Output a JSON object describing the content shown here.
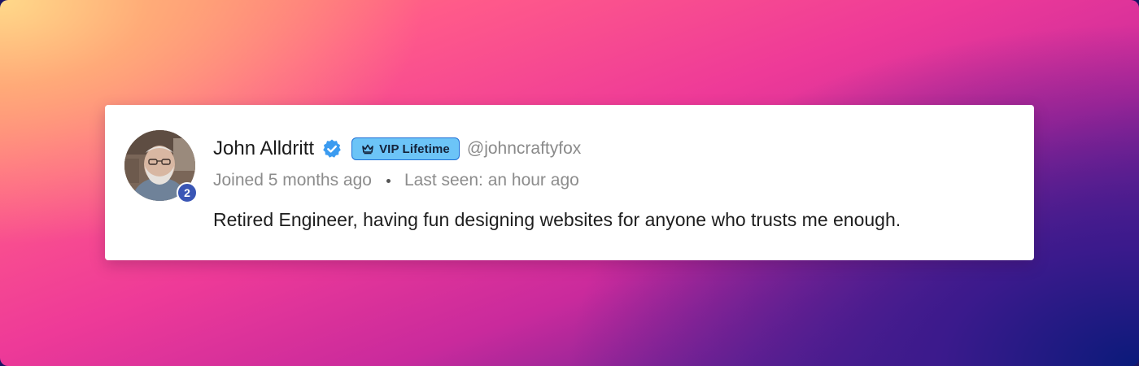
{
  "profile": {
    "name": "John Alldritt",
    "verified_icon": "verified-check-icon",
    "vip_badge": {
      "icon": "crown-icon",
      "label": "VIP Lifetime"
    },
    "handle": "@johncraftyfox",
    "avatar_level": "2",
    "joined": "Joined 5 months ago",
    "last_seen": "Last seen: an hour ago",
    "bio": "Retired Engineer, having fun designing websites for anyone who trusts me enough."
  },
  "colors": {
    "card_background": "#ffffff",
    "verified": "#3b9bf0",
    "vip_background": "#6cc4f7",
    "vip_border": "#1f6fd6",
    "level_badge": "#3a56b5",
    "muted_text": "#8c8c8c"
  }
}
